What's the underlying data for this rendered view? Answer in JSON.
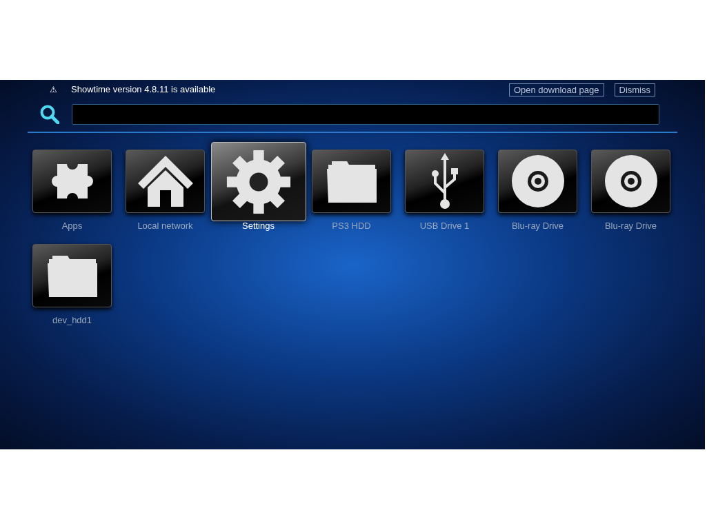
{
  "notification": {
    "icon": "⚠",
    "message": "Showtime version 4.8.11 is available",
    "buttons": [
      "Open download page",
      "Dismiss"
    ]
  },
  "items": [
    {
      "label": "Apps",
      "kind": "puzzle",
      "selected": false
    },
    {
      "label": "Local network",
      "kind": "home",
      "selected": false
    },
    {
      "label": "Settings",
      "kind": "gear",
      "selected": true
    },
    {
      "label": "PS3 HDD",
      "kind": "folder",
      "selected": false
    },
    {
      "label": "USB Drive 1",
      "kind": "usb",
      "selected": false
    },
    {
      "label": "Blu-ray Drive",
      "kind": "disc",
      "selected": false
    },
    {
      "label": "Blu-ray Drive",
      "kind": "disc",
      "selected": false
    },
    {
      "label": "dev_hdd1",
      "kind": "folder",
      "selected": false
    }
  ]
}
